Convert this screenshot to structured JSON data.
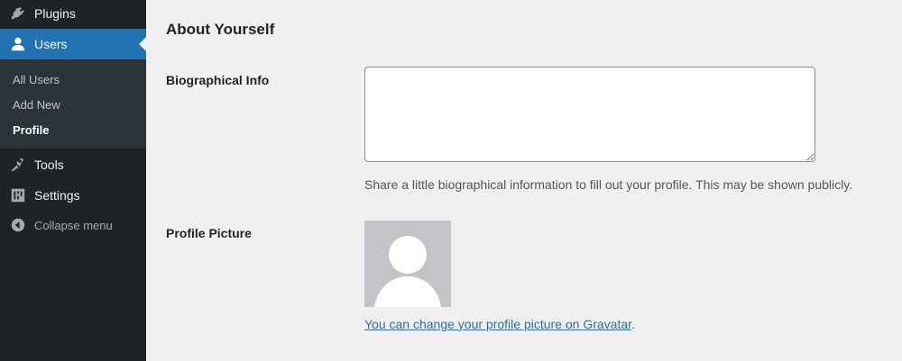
{
  "sidebar": {
    "items": [
      {
        "label": "Plugins",
        "icon": "plugin-icon"
      },
      {
        "label": "Users",
        "icon": "user-icon",
        "active": true
      },
      {
        "label": "Tools",
        "icon": "wrench-icon"
      },
      {
        "label": "Settings",
        "icon": "settings-sliders-icon"
      }
    ],
    "submenu": [
      {
        "label": "All Users"
      },
      {
        "label": "Add New"
      },
      {
        "label": "Profile",
        "current": true
      }
    ],
    "collapse_label": "Collapse menu"
  },
  "main": {
    "section_title": "About Yourself",
    "bio": {
      "label": "Biographical Info",
      "value": "",
      "description": "Share a little biographical information to fill out your profile. This may be shown publicly."
    },
    "picture": {
      "label": "Profile Picture",
      "link_text": "You can change your profile picture on Gravatar",
      "link_suffix": "."
    }
  },
  "colors": {
    "sidebar_bg": "#1d2327",
    "submenu_bg": "#2c3338",
    "accent": "#2271b1",
    "page_bg": "#f0f0f1"
  }
}
